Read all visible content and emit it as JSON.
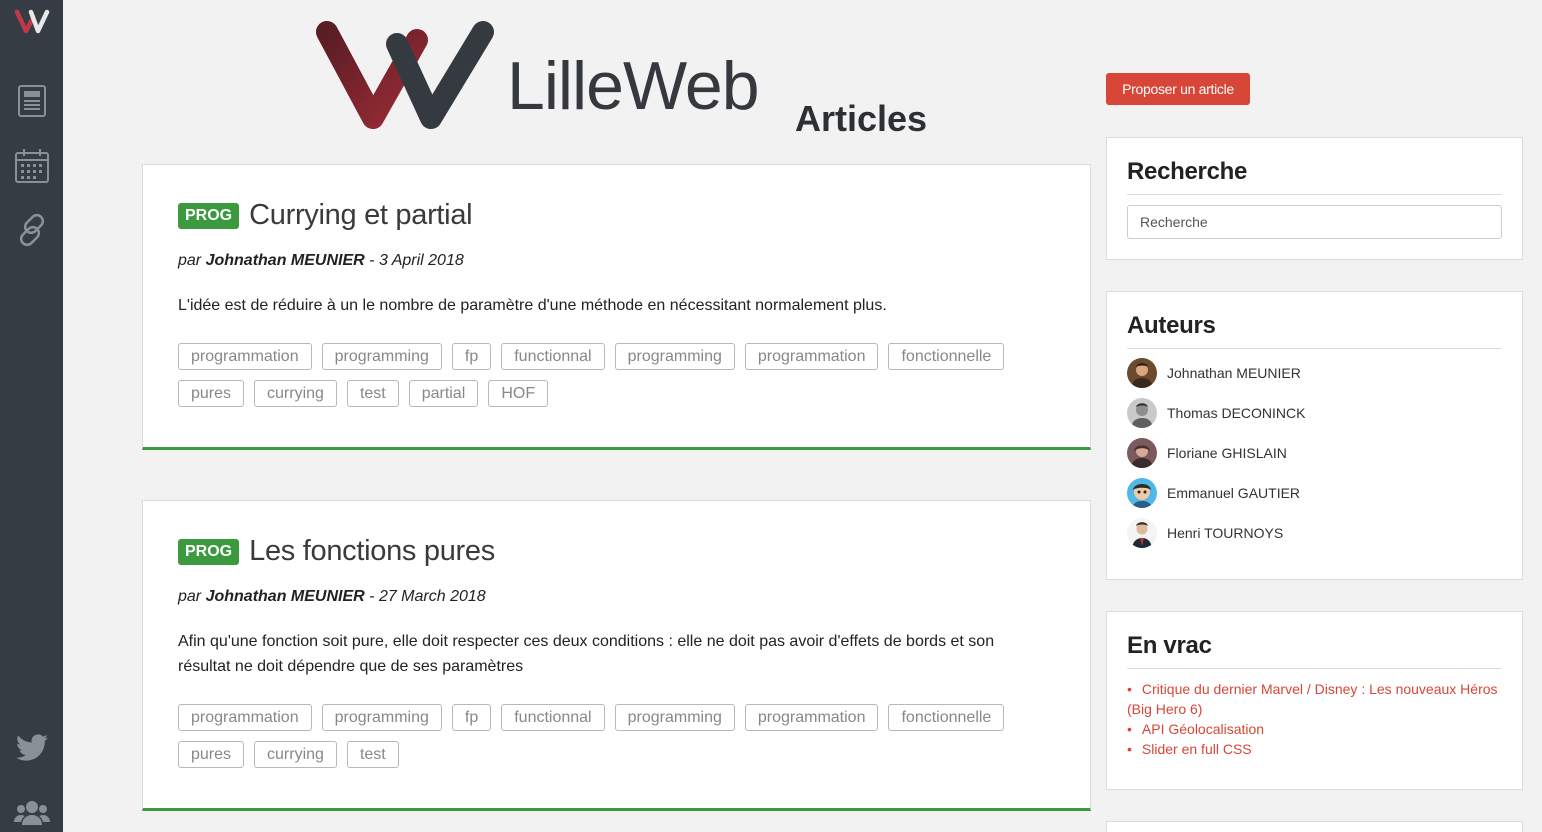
{
  "header": {
    "site_name": "LilleWeb",
    "section": "Articles",
    "propose_button": "Proposer un article"
  },
  "sidebar": {
    "icons": [
      "logo-icon",
      "newspaper-icon",
      "calendar-icon",
      "link-icon",
      "twitter-icon",
      "users-icon"
    ]
  },
  "articles": [
    {
      "badge": "PROG",
      "title": "Currying et partial",
      "by_prefix": "par",
      "author": "Johnathan MEUNIER",
      "date_sep": "-",
      "date": "3 April 2018",
      "excerpt": "L'idée est de réduire à un le nombre de paramètre d'une méthode en nécessitant normalement plus.",
      "tags": [
        "programmation",
        "programming",
        "fp",
        "functionnal",
        "programming",
        "programmation",
        "fonctionnelle",
        "pures",
        "currying",
        "test",
        "partial",
        "HOF"
      ]
    },
    {
      "badge": "PROG",
      "title": "Les fonctions pures",
      "by_prefix": "par",
      "author": "Johnathan MEUNIER",
      "date_sep": "-",
      "date": "27 March 2018",
      "excerpt": "Afin qu'une fonction soit pure, elle doit respecter ces deux conditions : elle ne doit pas avoir d'effets de bords et son résultat ne doit dépendre que de ses paramètres",
      "tags": [
        "programmation",
        "programming",
        "fp",
        "functionnal",
        "programming",
        "programmation",
        "fonctionnelle",
        "pures",
        "currying",
        "test"
      ]
    }
  ],
  "search_widget": {
    "title": "Recherche",
    "placeholder": "Recherche"
  },
  "authors_widget": {
    "title": "Auteurs",
    "authors": [
      "Johnathan MEUNIER",
      "Thomas DECONINCK",
      "Floriane GHISLAIN",
      "Emmanuel GAUTIER",
      "Henri TOURNOYS"
    ]
  },
  "vrac_widget": {
    "title": "En vrac",
    "links": [
      "Critique du dernier Marvel / Disney : Les nouveaux Héros (Big Hero 6)",
      "API Géolocalisation",
      "Slider en full CSS"
    ]
  },
  "colors": {
    "sidebar_bg": "#363c43",
    "accent_red": "#d74636",
    "prog_green": "#3b9a3d",
    "logo_dark_red": "#8b2731"
  }
}
